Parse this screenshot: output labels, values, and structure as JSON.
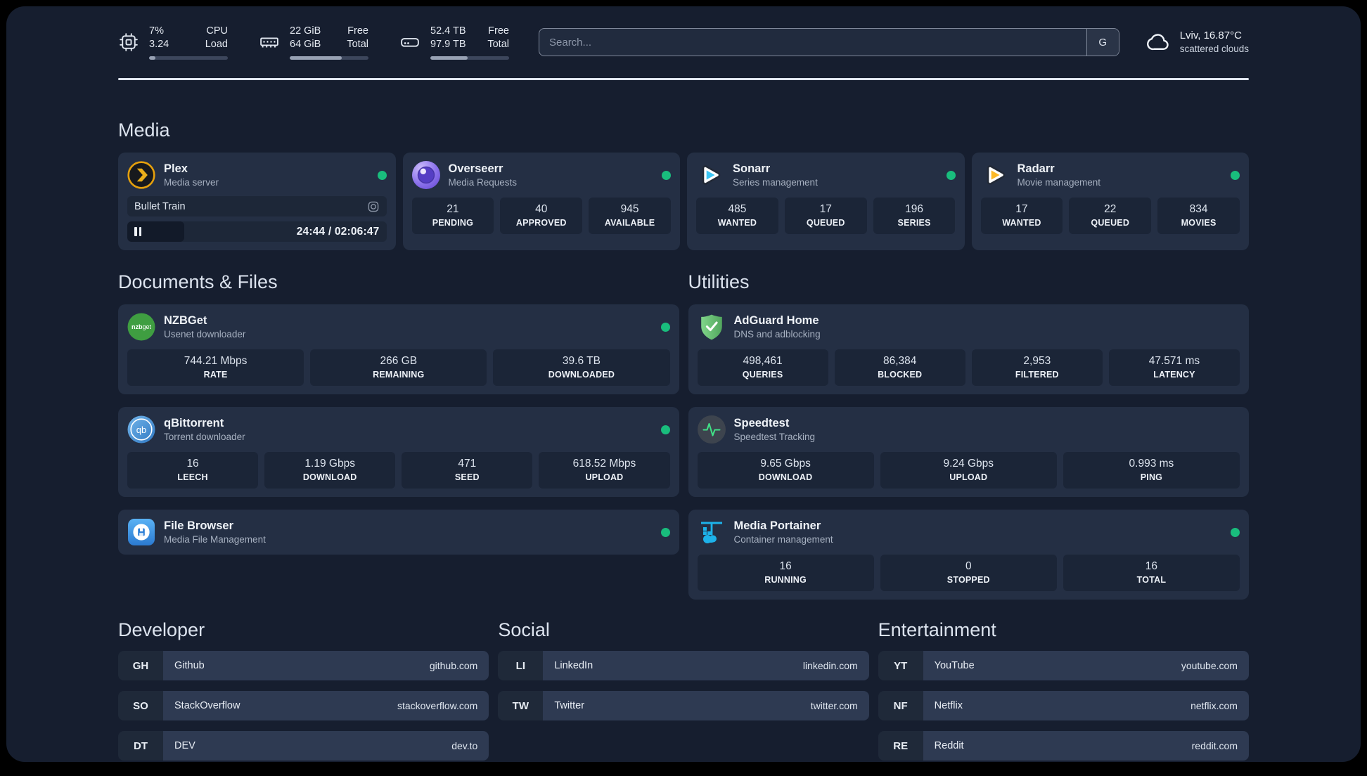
{
  "colors": {
    "background": "#161e2f",
    "card": "#242f44",
    "stat_box": "#1b2537",
    "status_green": "#19bd7d",
    "plex_amber": "#e5a00d",
    "sonarr_cyan": "#3bc5f4",
    "radarr_amber": "#fdb927",
    "portainer_blue": "#1db2ea",
    "divider": "#dfe5ee"
  },
  "topbar": {
    "cpu": {
      "v1": "7%",
      "v2": "3.24",
      "l1": "CPU",
      "l2": "Load",
      "bar_style": "width:8%"
    },
    "ram": {
      "v1": "22 GiB",
      "v2": "64 GiB",
      "l1": "Free",
      "l2": "Total",
      "bar_style": "width:66%"
    },
    "disk": {
      "v1": "52.4 TB",
      "v2": "97.9 TB",
      "l1": "Free",
      "l2": "Total",
      "bar_style": "width:47%"
    },
    "search": {
      "placeholder": "Search...",
      "button_label": "G"
    },
    "weather": {
      "location": "Lviv, 16.87°C",
      "condition": "scattered clouds"
    }
  },
  "media": {
    "title": "Media",
    "plex": {
      "name": "Plex",
      "desc": "Media server",
      "now_playing": "Bullet Train",
      "time": "24:44 / 02:06:47",
      "fill_style": "width:22%"
    },
    "overseerr": {
      "name": "Overseerr",
      "desc": "Media Requests",
      "stats": [
        {
          "v": "21",
          "l": "PENDING"
        },
        {
          "v": "40",
          "l": "APPROVED"
        },
        {
          "v": "945",
          "l": "AVAILABLE"
        }
      ]
    },
    "sonarr": {
      "name": "Sonarr",
      "desc": "Series management",
      "stats": [
        {
          "v": "485",
          "l": "WANTED"
        },
        {
          "v": "17",
          "l": "QUEUED"
        },
        {
          "v": "196",
          "l": "SERIES"
        }
      ]
    },
    "radarr": {
      "name": "Radarr",
      "desc": "Movie management",
      "stats": [
        {
          "v": "17",
          "l": "WANTED"
        },
        {
          "v": "22",
          "l": "QUEUED"
        },
        {
          "v": "834",
          "l": "MOVIES"
        }
      ]
    }
  },
  "documents": {
    "title": "Documents & Files",
    "nzbget": {
      "name": "NZBGet",
      "desc": "Usenet downloader",
      "stats": [
        {
          "v": "744.21 Mbps",
          "l": "RATE"
        },
        {
          "v": "266 GB",
          "l": "REMAINING"
        },
        {
          "v": "39.6 TB",
          "l": "DOWNLOADED"
        }
      ]
    },
    "qbittorrent": {
      "name": "qBittorrent",
      "desc": "Torrent downloader",
      "stats": [
        {
          "v": "16",
          "l": "LEECH"
        },
        {
          "v": "1.19 Gbps",
          "l": "DOWNLOAD"
        },
        {
          "v": "471",
          "l": "SEED"
        },
        {
          "v": "618.52 Mbps",
          "l": "UPLOAD"
        }
      ]
    },
    "filebrowser": {
      "name": "File Browser",
      "desc": "Media File Management"
    }
  },
  "utilities": {
    "title": "Utilities",
    "adguard": {
      "name": "AdGuard Home",
      "desc": "DNS and adblocking",
      "stats": [
        {
          "v": "498,461",
          "l": "QUERIES"
        },
        {
          "v": "86,384",
          "l": "BLOCKED"
        },
        {
          "v": "2,953",
          "l": "FILTERED"
        },
        {
          "v": "47.571 ms",
          "l": "LATENCY"
        }
      ]
    },
    "speedtest": {
      "name": "Speedtest",
      "desc": "Speedtest Tracking",
      "stats": [
        {
          "v": "9.65 Gbps",
          "l": "DOWNLOAD"
        },
        {
          "v": "9.24 Gbps",
          "l": "UPLOAD"
        },
        {
          "v": "0.993 ms",
          "l": "PING"
        }
      ]
    },
    "portainer": {
      "name": "Media Portainer",
      "desc": "Container management",
      "stats": [
        {
          "v": "16",
          "l": "RUNNING"
        },
        {
          "v": "0",
          "l": "STOPPED"
        },
        {
          "v": "16",
          "l": "TOTAL"
        }
      ]
    }
  },
  "bookmarks": {
    "developer": {
      "title": "Developer",
      "items": [
        {
          "abbr": "GH",
          "name": "Github",
          "url": "github.com"
        },
        {
          "abbr": "SO",
          "name": "StackOverflow",
          "url": "stackoverflow.com"
        },
        {
          "abbr": "DT",
          "name": "DEV",
          "url": "dev.to"
        }
      ]
    },
    "social": {
      "title": "Social",
      "items": [
        {
          "abbr": "LI",
          "name": "LinkedIn",
          "url": "linkedin.com"
        },
        {
          "abbr": "TW",
          "name": "Twitter",
          "url": "twitter.com"
        }
      ]
    },
    "entertainment": {
      "title": "Entertainment",
      "items": [
        {
          "abbr": "YT",
          "name": "YouTube",
          "url": "youtube.com"
        },
        {
          "abbr": "NF",
          "name": "Netflix",
          "url": "netflix.com"
        },
        {
          "abbr": "RE",
          "name": "Reddit",
          "url": "reddit.com"
        }
      ]
    }
  }
}
